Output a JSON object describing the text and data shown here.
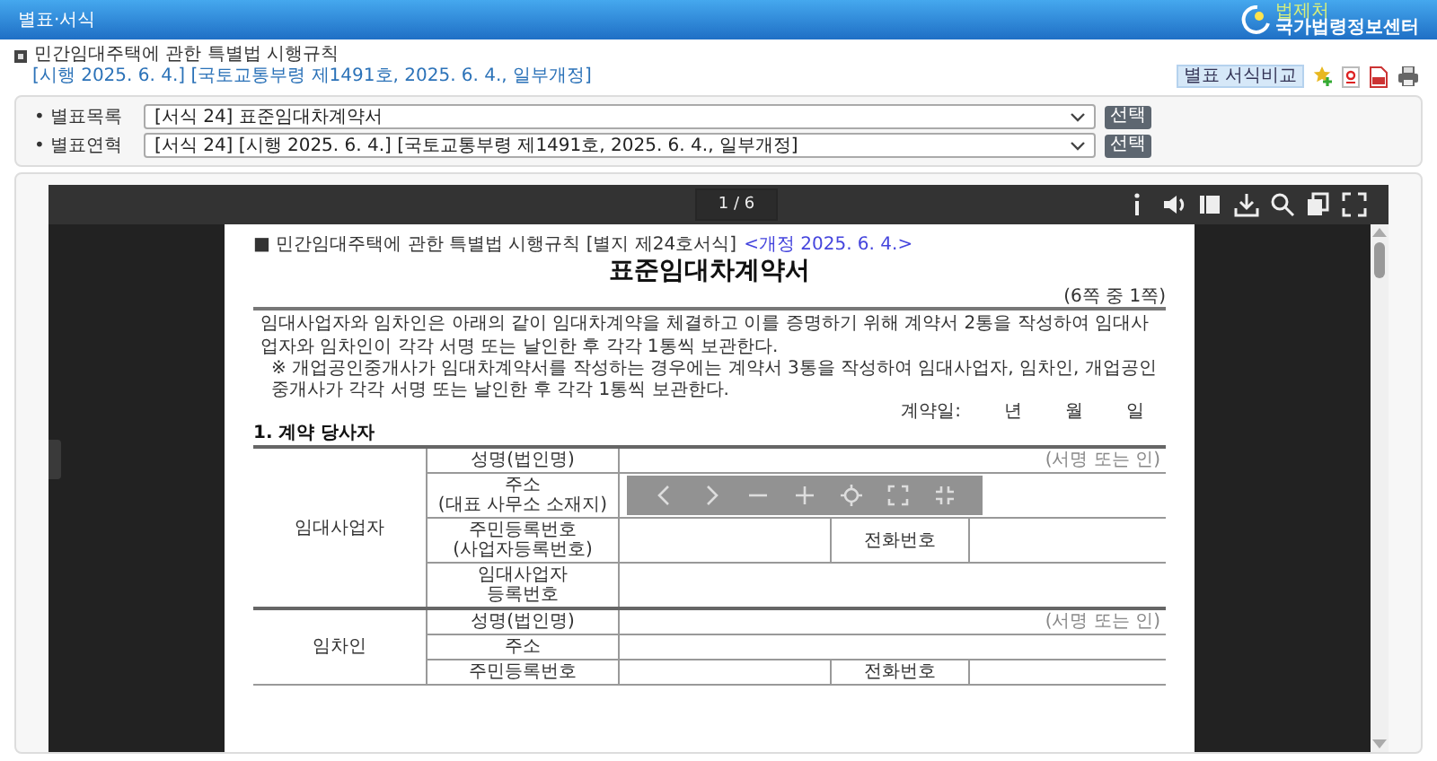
{
  "header": {
    "title": "별표·서식",
    "logo_small": "법제처",
    "logo": "국가법령정보센터"
  },
  "law": {
    "title": "민간임대주택에 관한 특별법 시행규칙",
    "info": "[시행 2025. 6. 4.] [국토교통부령 제1491호, 2025. 6. 4., 일부개정]"
  },
  "actions": {
    "compare_button": "별표 서식비교"
  },
  "selectors": [
    {
      "label": "• 별표목록",
      "value": "[서식 24] 표준임대차계약서",
      "button": "선택"
    },
    {
      "label": "• 별표연혁",
      "value": "[서식 24] [시행 2025. 6. 4.] [국토교통부령 제1491호, 2025. 6. 4., 일부개정]",
      "button": "선택"
    }
  ],
  "viewer": {
    "page": "1 / 6"
  },
  "document": {
    "header": "■ 민간임대주택에 관한 특별법 시행규칙 [별지 제24호서식]",
    "amendment": "<개정 2025. 6. 4.>",
    "title": "표준임대차계약서",
    "page_note": "(6쪽 중 1쪽)",
    "paragraph": "임대사업자와 임차인은 아래의 같이 임대차계약을 체결하고 이를 증명하기 위해 계약서 2통을 작성하여 임대사업자와 임차인이 각각 서명 또는 날인한 후 각각 1통씩 보관한다.",
    "note": "※ 개업공인중개사가 임대차계약서를 작성하는 경우에는 계약서 3통을 작성하여 임대사업자, 임차인, 개업공인중개사가 각각 서명 또는 날인한 후 각각 1통씩 보관한다.",
    "contract_date": {
      "label": "계약일:",
      "year": "년",
      "month": "월",
      "day": "일"
    },
    "section": "1. 계약 당사자",
    "parties": [
      {
        "role": "임대사업자",
        "rows": [
          {
            "kind": "sign",
            "label": "성명(법인명)",
            "hint": "(서명 또는 인)"
          },
          {
            "kind": "plain",
            "label": "주소\n(대표 사무소 소재지)"
          },
          {
            "kind": "phone",
            "label": "주민등록번호\n(사업자등록번호)",
            "phone_label": "전화번호"
          },
          {
            "kind": "plain",
            "label": "임대사업자\n등록번호"
          }
        ]
      },
      {
        "role": "임차인",
        "rows": [
          {
            "kind": "sign",
            "label": "성명(법인명)",
            "hint": "(서명 또는 인)"
          },
          {
            "kind": "plain",
            "label": "주소"
          },
          {
            "kind": "phone",
            "label": "주민등록번호",
            "phone_label": "전화번호"
          }
        ]
      }
    ]
  }
}
